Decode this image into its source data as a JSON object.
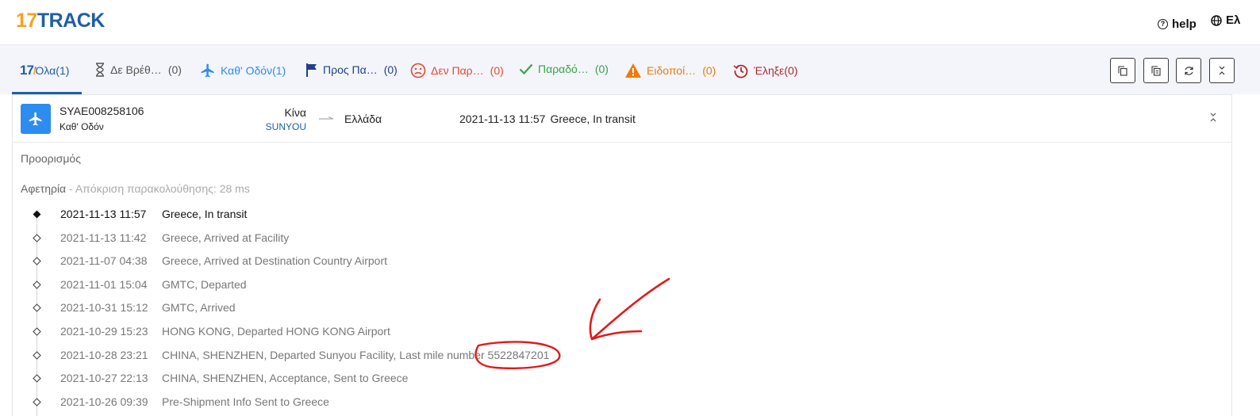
{
  "brand": {
    "logo_num": "17",
    "logo_text": "TRACK"
  },
  "topnav": {
    "help_label": "help",
    "lang_label": "Ελ"
  },
  "tabs": [
    {
      "label": "Όλα",
      "count": "(1)",
      "color": "#1f5ea8"
    },
    {
      "label": "Δε Βρέθ…",
      "count": "(0)",
      "color": "#555555"
    },
    {
      "label": "Καθ' Οδόν",
      "count": "(1)",
      "color": "#2d8cf0"
    },
    {
      "label": "Προς Πα…",
      "count": "(0)",
      "color": "#1f3f8f"
    },
    {
      "label": "Δεν Παρ…",
      "count": "(0)",
      "color": "#e8482f"
    },
    {
      "label": "Παραδό…",
      "count": "(0)",
      "color": "#3aa34a"
    },
    {
      "label": "Ειδοποί…",
      "count": "(0)",
      "color": "#f07a0c"
    },
    {
      "label": "Έληξε",
      "count": "(0)",
      "color": "#b3262a"
    }
  ],
  "toolbar": {
    "icons": [
      "copy-icon",
      "copy-all-icon",
      "refresh-icon",
      "collapse-all-icon"
    ]
  },
  "shipment": {
    "tracking_number": "SYAE008258106",
    "status": "Καθ' Οδόν",
    "origin_country": "Κίνα",
    "carrier": "SUNYOU",
    "destination_country": "Ελλάδα",
    "latest_date": "2021-11-13 11:57",
    "latest_event": "Greece, In transit"
  },
  "sections": {
    "destination_label": "Προορισμός",
    "origin_label": "Αφετηρία",
    "origin_sub": " - Απόκριση παρακολούθησης: 28 ms"
  },
  "events": [
    {
      "date": "2021-11-13 11:57",
      "desc": "Greece, In transit"
    },
    {
      "date": "2021-11-13 11:42",
      "desc": "Greece, Arrived at Facility"
    },
    {
      "date": "2021-11-07 04:38",
      "desc": "Greece, Arrived at Destination Country Airport"
    },
    {
      "date": "2021-11-01 15:04",
      "desc": "GMTC, Departed"
    },
    {
      "date": "2021-10-31 15:12",
      "desc": "GMTC, Arrived"
    },
    {
      "date": "2021-10-29 15:23",
      "desc": "HONG KONG, Departed HONG KONG Airport"
    },
    {
      "date": "2021-10-28 23:21",
      "desc": "CHINA, SHENZHEN, Departed Sunyou Facility, Last mile number 5522847201"
    },
    {
      "date": "2021-10-27 22:13",
      "desc": "CHINA, SHENZHEN, Acceptance, Sent to Greece"
    },
    {
      "date": "2021-10-26 09:39",
      "desc": "Pre-Shipment Info Sent to Greece"
    }
  ],
  "annotation": {
    "color": "#e01b1b"
  }
}
